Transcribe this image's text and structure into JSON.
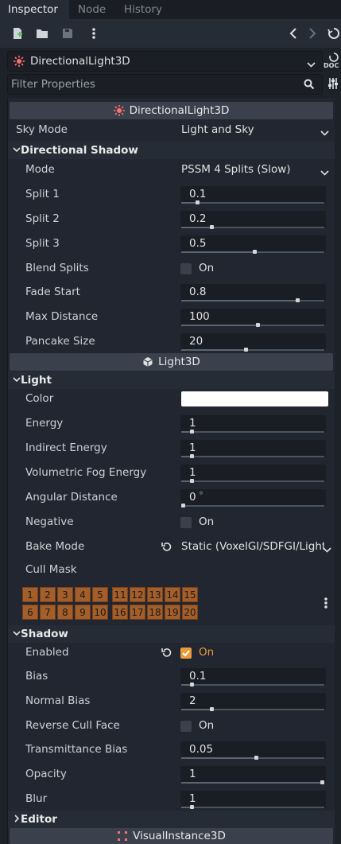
{
  "tabs": [
    {
      "label": "Inspector",
      "active": true
    },
    {
      "label": "Node",
      "active": false
    },
    {
      "label": "History",
      "active": false
    }
  ],
  "toolbar": {
    "icons": [
      "new-resource-icon",
      "open-folder-icon",
      "save-icon",
      "more-vertical-icon",
      "history-back-icon",
      "history-forward-icon",
      "object-tools-icon"
    ]
  },
  "node_selector": {
    "value": "DirectionalLight3D"
  },
  "side": {
    "doc_label": "DOC"
  },
  "filter": {
    "placeholder": "Filter Properties"
  },
  "sections": {
    "directional": "DirectionalLight3D",
    "light3d": "Light3D",
    "visual": "VisualInstance3D"
  },
  "sky_mode": {
    "label": "Sky Mode",
    "value": "Light and Sky"
  },
  "directional_shadow": {
    "title": "Directional Shadow",
    "mode": {
      "label": "Mode",
      "value": "PSSM 4 Splits (Slow)"
    },
    "split1": {
      "label": "Split 1",
      "value": "0.1",
      "ratio": 0.1
    },
    "split2": {
      "label": "Split 2",
      "value": "0.2",
      "ratio": 0.2
    },
    "split3": {
      "label": "Split 3",
      "value": "0.5",
      "ratio": 0.5
    },
    "blend_splits": {
      "label": "Blend Splits",
      "on_label": "On",
      "checked": false
    },
    "fade_start": {
      "label": "Fade Start",
      "value": "0.8",
      "ratio": 0.8
    },
    "max_distance": {
      "label": "Max Distance",
      "value": "100",
      "ratio": 0.52
    },
    "pancake_size": {
      "label": "Pancake Size",
      "value": "20",
      "ratio": 0.44
    }
  },
  "light": {
    "title": "Light",
    "color": {
      "label": "Color",
      "value": "#ffffff"
    },
    "energy": {
      "label": "Energy",
      "value": "1",
      "ratio": 0.06
    },
    "indirect_energy": {
      "label": "Indirect Energy",
      "value": "1",
      "ratio": 0.06
    },
    "volumetric_fog_energy": {
      "label": "Volumetric Fog Energy",
      "value": "1",
      "ratio": 0.06
    },
    "angular_distance": {
      "label": "Angular Distance",
      "value": "0",
      "unit": "°",
      "ratio": 0.0
    },
    "negative": {
      "label": "Negative",
      "on_label": "On",
      "checked": false
    },
    "bake_mode": {
      "label": "Bake Mode",
      "value": "Static (VoxelGI/SDFGI/LightmapGI)"
    },
    "cull_mask": {
      "label": "Cull Mask",
      "layers": [
        "1",
        "2",
        "3",
        "4",
        "5",
        "6",
        "7",
        "8",
        "9",
        "10",
        "11",
        "12",
        "13",
        "14",
        "15",
        "16",
        "17",
        "18",
        "19",
        "20"
      ]
    }
  },
  "shadow": {
    "title": "Shadow",
    "enabled": {
      "label": "Enabled",
      "on_label": "On",
      "checked": true
    },
    "bias": {
      "label": "Bias",
      "value": "0.1",
      "ratio": 0.06
    },
    "normal_bias": {
      "label": "Normal Bias",
      "value": "2",
      "ratio": 0.2
    },
    "reverse_cull_face": {
      "label": "Reverse Cull Face",
      "on_label": "On",
      "checked": false
    },
    "transmittance_bias": {
      "label": "Transmittance Bias",
      "value": "0.05",
      "ratio": 0.51
    },
    "opacity": {
      "label": "Opacity",
      "value": "1",
      "ratio": 1.0
    },
    "blur": {
      "label": "Blur",
      "value": "1",
      "ratio": 0.06
    }
  },
  "editor": {
    "title": "Editor"
  },
  "colors": {
    "accent": "#e89b3a",
    "light_icon": "#ff6f6f",
    "cullmask": "#a45e29"
  }
}
